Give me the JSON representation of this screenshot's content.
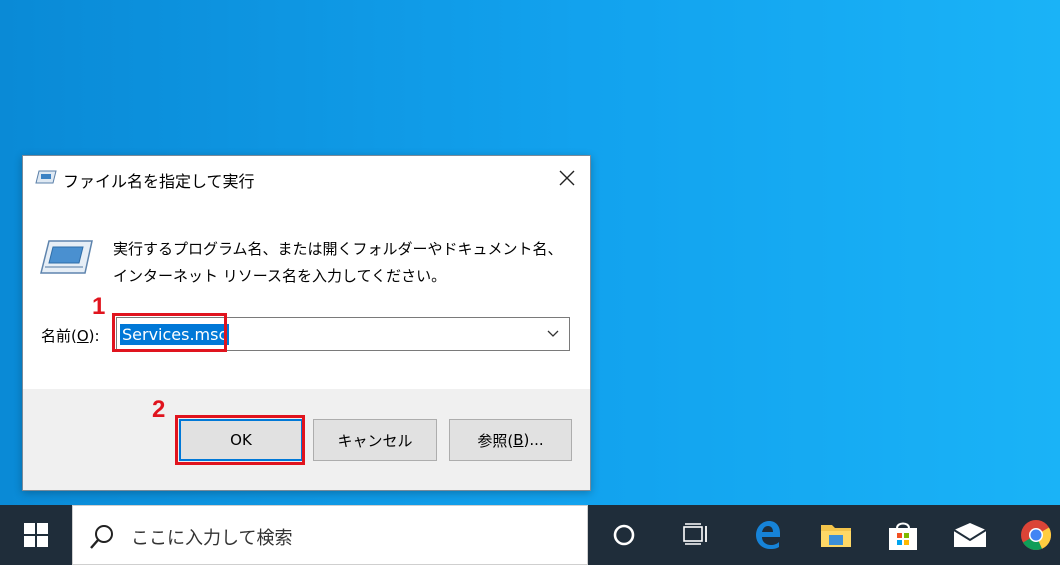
{
  "dialog": {
    "title": "ファイル名を指定して実行",
    "description": "実行するプログラム名、または開くフォルダーやドキュメント名、インターネット リソース名を入力してください。",
    "name_label_prefix": "名前(",
    "name_label_key": "O",
    "name_label_suffix": "):",
    "input_value": "Services.msc",
    "ok_label": "OK",
    "cancel_label": "キャンセル",
    "browse_label_prefix": "参照(",
    "browse_label_key": "B",
    "browse_label_suffix": ")..."
  },
  "annotations": {
    "step1": "1",
    "step2": "2",
    "color": "#e0141e"
  },
  "taskbar": {
    "search_placeholder": "ここに入力して検索",
    "icons": [
      "windows-start-icon",
      "cortana-icon",
      "task-view-icon",
      "edge-icon",
      "file-explorer-icon",
      "store-icon",
      "mail-icon",
      "chrome-icon"
    ]
  },
  "colors": {
    "selection": "#0078d7",
    "taskbar": "#1f2d3a"
  }
}
